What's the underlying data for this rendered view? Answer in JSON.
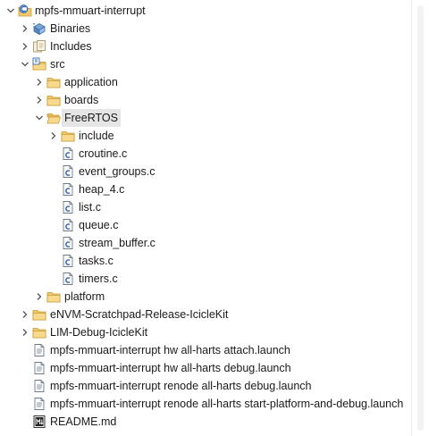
{
  "tree": {
    "project": {
      "label": "mpfs-mmuart-interrupt",
      "icon": "c-project-icon"
    },
    "binaries": {
      "label": "Binaries",
      "icon": "binaries-icon"
    },
    "includes": {
      "label": "Includes",
      "icon": "includes-icon"
    },
    "src": {
      "label": "src",
      "icon": "source-folder-icon"
    },
    "application": {
      "label": "application",
      "icon": "folder-icon"
    },
    "boards": {
      "label": "boards",
      "icon": "folder-icon"
    },
    "freertos": {
      "label": "FreeRTOS",
      "icon": "folder-open-icon"
    },
    "include": {
      "label": "include",
      "icon": "folder-icon"
    },
    "files": [
      "croutine.c",
      "event_groups.c",
      "heap_4.c",
      "list.c",
      "queue.c",
      "stream_buffer.c",
      "tasks.c",
      "timers.c"
    ],
    "platform": {
      "label": "platform",
      "icon": "folder-icon"
    },
    "envm": {
      "label": "eNVM-Scratchpad-Release-IcicleKit",
      "icon": "folder-icon"
    },
    "lim": {
      "label": "LIM-Debug-IcicleKit",
      "icon": "folder-icon"
    },
    "launch_files": [
      "mpfs-mmuart-interrupt hw all-harts attach.launch",
      "mpfs-mmuart-interrupt hw all-harts debug.launch",
      "mpfs-mmuart-interrupt renode all-harts debug.launch",
      "mpfs-mmuart-interrupt renode all-harts start-platform-and-debug.launch"
    ],
    "readme": {
      "label": "README.md",
      "icon": "markdown-file-icon"
    },
    "selected": "FreeRTOS"
  }
}
